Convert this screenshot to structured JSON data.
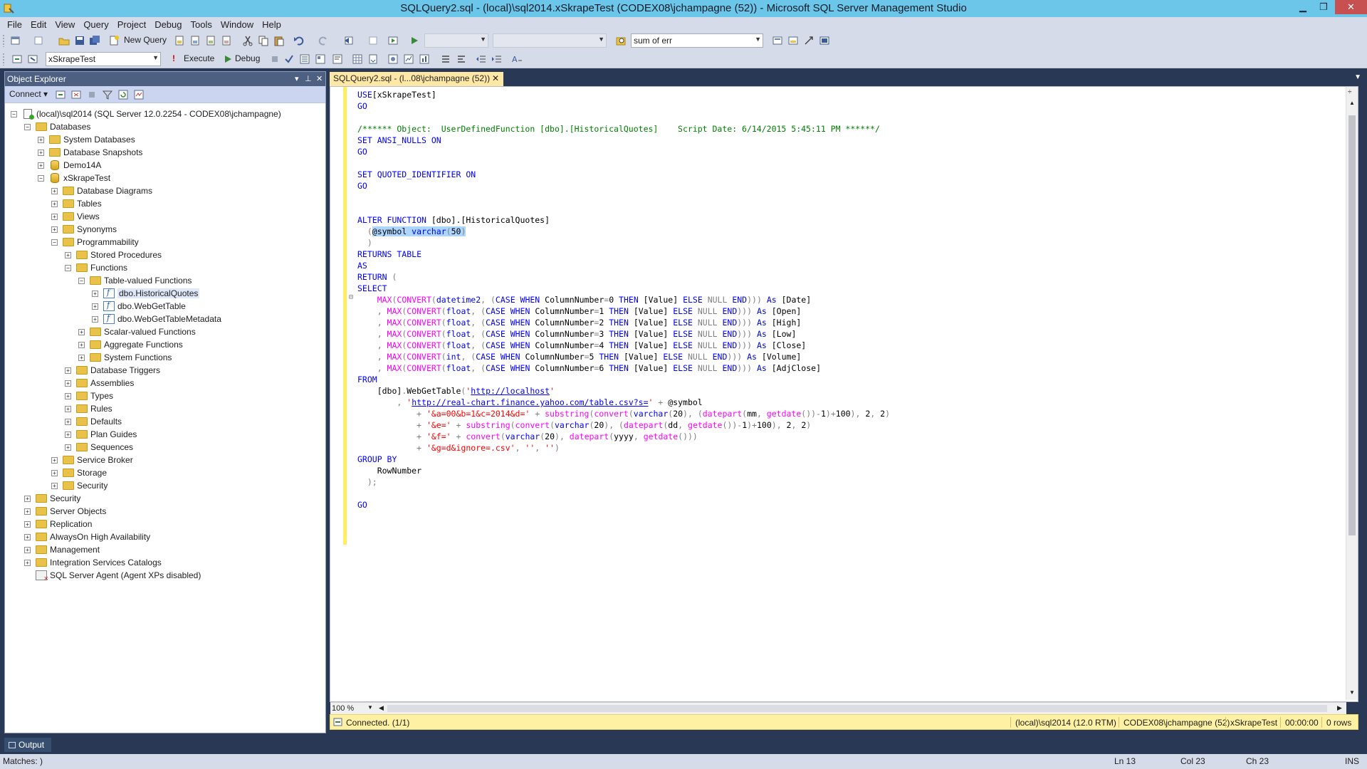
{
  "window": {
    "title": "SQLQuery2.sql - (local)\\sql2014.xSkrapeTest (CODEX08\\jchampagne (52)) - Microsoft SQL Server Management Studio",
    "minimize": "▁",
    "maximize": "❐",
    "close": "✕"
  },
  "menu": [
    "File",
    "Edit",
    "View",
    "Query",
    "Project",
    "Debug",
    "Tools",
    "Window",
    "Help"
  ],
  "toolbar1": {
    "new_query": "New Query",
    "search_combo": "sum of err"
  },
  "toolbar2": {
    "database": "xSkrapeTest",
    "execute": "Execute",
    "debug": "Debug"
  },
  "object_explorer": {
    "title": "Object Explorer",
    "connect": "Connect ▾",
    "tree": [
      {
        "label": "(local)\\sql2014 (SQL Server 12.0.2254 - CODEX08\\jchampagne)",
        "icon": "server-icon",
        "exp": "−"
      },
      {
        "label": "Databases",
        "icon": "folder-icon",
        "exp": "−"
      },
      {
        "label": "System Databases",
        "icon": "folder-icon",
        "exp": "+"
      },
      {
        "label": "Database Snapshots",
        "icon": "folder-icon",
        "exp": "+"
      },
      {
        "label": "Demo14A",
        "icon": "database-icon",
        "exp": "+"
      },
      {
        "label": "xSkrapeTest",
        "icon": "database-icon",
        "exp": "−"
      },
      {
        "label": "Database Diagrams",
        "icon": "folder-icon",
        "exp": "+"
      },
      {
        "label": "Tables",
        "icon": "folder-icon",
        "exp": "+"
      },
      {
        "label": "Views",
        "icon": "folder-icon",
        "exp": "+"
      },
      {
        "label": "Synonyms",
        "icon": "folder-icon",
        "exp": "+"
      },
      {
        "label": "Programmability",
        "icon": "folder-icon",
        "exp": "−"
      },
      {
        "label": "Stored Procedures",
        "icon": "folder-icon",
        "exp": "+"
      },
      {
        "label": "Functions",
        "icon": "folder-icon",
        "exp": "−"
      },
      {
        "label": "Table-valued Functions",
        "icon": "folder-icon",
        "exp": "−"
      },
      {
        "label": "dbo.HistoricalQuotes",
        "icon": "function-icon",
        "exp": "+",
        "selected": true
      },
      {
        "label": "dbo.WebGetTable",
        "icon": "function-icon",
        "exp": "+"
      },
      {
        "label": "dbo.WebGetTableMetadata",
        "icon": "function-icon",
        "exp": "+"
      },
      {
        "label": "Scalar-valued Functions",
        "icon": "folder-icon",
        "exp": "+"
      },
      {
        "label": "Aggregate Functions",
        "icon": "folder-icon",
        "exp": "+"
      },
      {
        "label": "System Functions",
        "icon": "folder-icon",
        "exp": "+"
      },
      {
        "label": "Database Triggers",
        "icon": "folder-icon",
        "exp": "+"
      },
      {
        "label": "Assemblies",
        "icon": "folder-icon",
        "exp": "+"
      },
      {
        "label": "Types",
        "icon": "folder-icon",
        "exp": "+"
      },
      {
        "label": "Rules",
        "icon": "folder-icon",
        "exp": "+"
      },
      {
        "label": "Defaults",
        "icon": "folder-icon",
        "exp": "+"
      },
      {
        "label": "Plan Guides",
        "icon": "folder-icon",
        "exp": "+"
      },
      {
        "label": "Sequences",
        "icon": "folder-icon",
        "exp": "+"
      },
      {
        "label": "Service Broker",
        "icon": "folder-icon",
        "exp": "+"
      },
      {
        "label": "Storage",
        "icon": "folder-icon",
        "exp": "+"
      },
      {
        "label": "Security",
        "icon": "folder-icon",
        "exp": "+"
      },
      {
        "label": "Security",
        "icon": "folder-icon",
        "exp": "+"
      },
      {
        "label": "Server Objects",
        "icon": "folder-icon",
        "exp": "+"
      },
      {
        "label": "Replication",
        "icon": "folder-icon",
        "exp": "+"
      },
      {
        "label": "AlwaysOn High Availability",
        "icon": "folder-icon",
        "exp": "+"
      },
      {
        "label": "Management",
        "icon": "folder-icon",
        "exp": "+"
      },
      {
        "label": "Integration Services Catalogs",
        "icon": "folder-icon",
        "exp": "+"
      },
      {
        "label": "SQL Server Agent (Agent XPs disabled)",
        "icon": "agent-icon",
        "exp": ""
      }
    ]
  },
  "editor": {
    "tab_label": "SQLQuery2.sql - (l...08\\jchampagne (52))",
    "tab_close": "✕",
    "zoom": "100 %",
    "code_lines": [
      [
        [
          "kw",
          "USE"
        ],
        [
          "",
          "[xSkrapeTest]"
        ]
      ],
      [
        [
          "kw",
          "GO"
        ]
      ],
      [
        [
          "",
          ""
        ]
      ],
      [
        [
          "cm",
          "/****** Object:  UserDefinedFunction [dbo].[HistoricalQuotes]    Script Date: 6/14/2015 5:45:11 PM ******/"
        ]
      ],
      [
        [
          "kw",
          "SET ANSI_NULLS ON"
        ]
      ],
      [
        [
          "kw",
          "GO"
        ]
      ],
      [
        [
          "",
          ""
        ]
      ],
      [
        [
          "kw",
          "SET QUOTED_IDENTIFIER ON"
        ]
      ],
      [
        [
          "kw",
          "GO"
        ]
      ],
      [
        [
          "",
          ""
        ]
      ],
      [
        [
          "",
          ""
        ]
      ],
      [
        [
          "kw",
          "ALTER FUNCTION"
        ],
        [
          "",
          " [dbo].[HistoricalQuotes]"
        ]
      ],
      [
        [
          "gy",
          "  ("
        ],
        [
          "hl",
          "@symbol "
        ],
        [
          "hl-kw",
          "varchar"
        ],
        [
          "hl-gy",
          "("
        ],
        [
          "hl",
          "50"
        ],
        [
          "hl-gy",
          ")"
        ]
      ],
      [
        [
          "gy",
          "  )"
        ]
      ],
      [
        [
          "kw",
          "RETURNS TABLE"
        ]
      ],
      [
        [
          "kw",
          "AS"
        ]
      ],
      [
        [
          "kw",
          "RETURN"
        ],
        [
          "gy",
          " ("
        ]
      ],
      [
        [
          "kw",
          "SELECT"
        ]
      ],
      [
        [
          "",
          "    "
        ],
        [
          "fn",
          "MAX"
        ],
        [
          "gy",
          "("
        ],
        [
          "fn",
          "CONVERT"
        ],
        [
          "gy",
          "("
        ],
        [
          "kw",
          "datetime2"
        ],
        [
          "gy",
          ", ("
        ],
        [
          "kw",
          "CASE WHEN"
        ],
        [
          "",
          " ColumnNumber"
        ],
        [
          "gy",
          "="
        ],
        [
          "",
          "0 "
        ],
        [
          "kw",
          "THEN"
        ],
        [
          "",
          " [Value] "
        ],
        [
          "kw",
          "ELSE"
        ],
        [
          "gy",
          " NULL "
        ],
        [
          "kw",
          "END"
        ],
        [
          "gy",
          ")))"
        ],
        [
          "",
          " "
        ],
        [
          "kw",
          "As"
        ],
        [
          "",
          " [Date]"
        ]
      ],
      [
        [
          "gy",
          "    , "
        ],
        [
          "fn",
          "MAX"
        ],
        [
          "gy",
          "("
        ],
        [
          "fn",
          "CONVERT"
        ],
        [
          "gy",
          "("
        ],
        [
          "kw",
          "float"
        ],
        [
          "gy",
          ", ("
        ],
        [
          "kw",
          "CASE WHEN"
        ],
        [
          "",
          " ColumnNumber"
        ],
        [
          "gy",
          "="
        ],
        [
          "",
          "1 "
        ],
        [
          "kw",
          "THEN"
        ],
        [
          "",
          " [Value] "
        ],
        [
          "kw",
          "ELSE"
        ],
        [
          "gy",
          " NULL "
        ],
        [
          "kw",
          "END"
        ],
        [
          "gy",
          ")))"
        ],
        [
          "",
          " "
        ],
        [
          "kw",
          "As"
        ],
        [
          "",
          " [Open]"
        ]
      ],
      [
        [
          "gy",
          "    , "
        ],
        [
          "fn",
          "MAX"
        ],
        [
          "gy",
          "("
        ],
        [
          "fn",
          "CONVERT"
        ],
        [
          "gy",
          "("
        ],
        [
          "kw",
          "float"
        ],
        [
          "gy",
          ", ("
        ],
        [
          "kw",
          "CASE WHEN"
        ],
        [
          "",
          " ColumnNumber"
        ],
        [
          "gy",
          "="
        ],
        [
          "",
          "2 "
        ],
        [
          "kw",
          "THEN"
        ],
        [
          "",
          " [Value] "
        ],
        [
          "kw",
          "ELSE"
        ],
        [
          "gy",
          " NULL "
        ],
        [
          "kw",
          "END"
        ],
        [
          "gy",
          ")))"
        ],
        [
          "",
          " "
        ],
        [
          "kw",
          "As"
        ],
        [
          "",
          " [High]"
        ]
      ],
      [
        [
          "gy",
          "    , "
        ],
        [
          "fn",
          "MAX"
        ],
        [
          "gy",
          "("
        ],
        [
          "fn",
          "CONVERT"
        ],
        [
          "gy",
          "("
        ],
        [
          "kw",
          "float"
        ],
        [
          "gy",
          ", ("
        ],
        [
          "kw",
          "CASE WHEN"
        ],
        [
          "",
          " ColumnNumber"
        ],
        [
          "gy",
          "="
        ],
        [
          "",
          "3 "
        ],
        [
          "kw",
          "THEN"
        ],
        [
          "",
          " [Value] "
        ],
        [
          "kw",
          "ELSE"
        ],
        [
          "gy",
          " NULL "
        ],
        [
          "kw",
          "END"
        ],
        [
          "gy",
          ")))"
        ],
        [
          "",
          " "
        ],
        [
          "kw",
          "As"
        ],
        [
          "",
          " [Low]"
        ]
      ],
      [
        [
          "gy",
          "    , "
        ],
        [
          "fn",
          "MAX"
        ],
        [
          "gy",
          "("
        ],
        [
          "fn",
          "CONVERT"
        ],
        [
          "gy",
          "("
        ],
        [
          "kw",
          "float"
        ],
        [
          "gy",
          ", ("
        ],
        [
          "kw",
          "CASE WHEN"
        ],
        [
          "",
          " ColumnNumber"
        ],
        [
          "gy",
          "="
        ],
        [
          "",
          "4 "
        ],
        [
          "kw",
          "THEN"
        ],
        [
          "",
          " [Value] "
        ],
        [
          "kw",
          "ELSE"
        ],
        [
          "gy",
          " NULL "
        ],
        [
          "kw",
          "END"
        ],
        [
          "gy",
          ")))"
        ],
        [
          "",
          " "
        ],
        [
          "kw",
          "As"
        ],
        [
          "",
          " [Close]"
        ]
      ],
      [
        [
          "gy",
          "    , "
        ],
        [
          "fn",
          "MAX"
        ],
        [
          "gy",
          "("
        ],
        [
          "fn",
          "CONVERT"
        ],
        [
          "gy",
          "("
        ],
        [
          "kw",
          "int"
        ],
        [
          "gy",
          ", ("
        ],
        [
          "kw",
          "CASE WHEN"
        ],
        [
          "",
          " ColumnNumber"
        ],
        [
          "gy",
          "="
        ],
        [
          "",
          "5 "
        ],
        [
          "kw",
          "THEN"
        ],
        [
          "",
          " [Value] "
        ],
        [
          "kw",
          "ELSE"
        ],
        [
          "gy",
          " NULL "
        ],
        [
          "kw",
          "END"
        ],
        [
          "gy",
          ")))"
        ],
        [
          "",
          " "
        ],
        [
          "kw",
          "As"
        ],
        [
          "",
          " [Volume]"
        ]
      ],
      [
        [
          "gy",
          "    , "
        ],
        [
          "fn",
          "MAX"
        ],
        [
          "gy",
          "("
        ],
        [
          "fn",
          "CONVERT"
        ],
        [
          "gy",
          "("
        ],
        [
          "kw",
          "float"
        ],
        [
          "gy",
          ", ("
        ],
        [
          "kw",
          "CASE WHEN"
        ],
        [
          "",
          " ColumnNumber"
        ],
        [
          "gy",
          "="
        ],
        [
          "",
          "6 "
        ],
        [
          "kw",
          "THEN"
        ],
        [
          "",
          " [Value] "
        ],
        [
          "kw",
          "ELSE"
        ],
        [
          "gy",
          " NULL "
        ],
        [
          "kw",
          "END"
        ],
        [
          "gy",
          ")))"
        ],
        [
          "",
          " "
        ],
        [
          "kw",
          "As"
        ],
        [
          "",
          " [AdjClose]"
        ]
      ],
      [
        [
          "kw",
          "FROM"
        ]
      ],
      [
        [
          "",
          "    [dbo]"
        ],
        [
          "gy",
          "."
        ],
        [
          "",
          "WebGetTable"
        ],
        [
          "gy",
          "("
        ],
        [
          "st",
          "'"
        ],
        [
          "url",
          "http://localhost"
        ],
        [
          "st",
          "'"
        ]
      ],
      [
        [
          "gy",
          "        , "
        ],
        [
          "st",
          "'"
        ],
        [
          "url",
          "http://real-chart.finance.yahoo.com/table.csv?s="
        ],
        [
          "st",
          "'"
        ],
        [
          "gy",
          " + "
        ],
        [
          "",
          "@symbol"
        ]
      ],
      [
        [
          "gy",
          "            + "
        ],
        [
          "st",
          "'&a=00&b=1&c=2014&d='"
        ],
        [
          "gy",
          " + "
        ],
        [
          "fn",
          "substring"
        ],
        [
          "gy",
          "("
        ],
        [
          "fn",
          "convert"
        ],
        [
          "gy",
          "("
        ],
        [
          "kw",
          "varchar"
        ],
        [
          "gy",
          "("
        ],
        [
          "",
          "20"
        ],
        [
          "gy",
          "), ("
        ],
        [
          "fn",
          "datepart"
        ],
        [
          "gy",
          "("
        ],
        [
          "",
          "mm"
        ],
        [
          "gy",
          ", "
        ],
        [
          "fn",
          "getdate"
        ],
        [
          "gy",
          "())-"
        ],
        [
          "",
          "1"
        ],
        [
          "gy",
          ")+"
        ],
        [
          "",
          "100"
        ],
        [
          "gy",
          "), "
        ],
        [
          "",
          "2"
        ],
        [
          "gy",
          ", "
        ],
        [
          "",
          "2"
        ],
        [
          "gy",
          ")"
        ]
      ],
      [
        [
          "gy",
          "            + "
        ],
        [
          "st",
          "'&e='"
        ],
        [
          "gy",
          " + "
        ],
        [
          "fn",
          "substring"
        ],
        [
          "gy",
          "("
        ],
        [
          "fn",
          "convert"
        ],
        [
          "gy",
          "("
        ],
        [
          "kw",
          "varchar"
        ],
        [
          "gy",
          "("
        ],
        [
          "",
          "20"
        ],
        [
          "gy",
          "), ("
        ],
        [
          "fn",
          "datepart"
        ],
        [
          "gy",
          "("
        ],
        [
          "",
          "dd"
        ],
        [
          "gy",
          ", "
        ],
        [
          "fn",
          "getdate"
        ],
        [
          "gy",
          "())-"
        ],
        [
          "",
          "1"
        ],
        [
          "gy",
          ")+"
        ],
        [
          "",
          "100"
        ],
        [
          "gy",
          "), "
        ],
        [
          "",
          "2"
        ],
        [
          "gy",
          ", "
        ],
        [
          "",
          "2"
        ],
        [
          "gy",
          ")"
        ]
      ],
      [
        [
          "gy",
          "            + "
        ],
        [
          "st",
          "'&f='"
        ],
        [
          "gy",
          " + "
        ],
        [
          "fn",
          "convert"
        ],
        [
          "gy",
          "("
        ],
        [
          "kw",
          "varchar"
        ],
        [
          "gy",
          "("
        ],
        [
          "",
          "20"
        ],
        [
          "gy",
          "), "
        ],
        [
          "fn",
          "datepart"
        ],
        [
          "gy",
          "("
        ],
        [
          "",
          "yyyy"
        ],
        [
          "gy",
          ", "
        ],
        [
          "fn",
          "getdate"
        ],
        [
          "gy",
          "()))"
        ]
      ],
      [
        [
          "gy",
          "            + "
        ],
        [
          "st",
          "'&g=d&ignore=.csv'"
        ],
        [
          "gy",
          ", "
        ],
        [
          "st",
          "''"
        ],
        [
          "gy",
          ", "
        ],
        [
          "st",
          "''"
        ],
        [
          "gy",
          ")"
        ]
      ],
      [
        [
          "kw",
          "GROUP BY"
        ]
      ],
      [
        [
          "",
          "    RowNumber"
        ]
      ],
      [
        [
          "gy",
          "  );"
        ]
      ],
      [
        [
          "",
          ""
        ]
      ],
      [
        [
          "kw",
          "GO"
        ]
      ]
    ]
  },
  "query_status": {
    "connected": "Connected. (1/1)",
    "server": "(local)\\sql2014 (12.0 RTM)",
    "user": "CODEX08\\jchampagne (52)",
    "database": "xSkrapeTest",
    "time": "00:00:00",
    "rows": "0 rows"
  },
  "output_tab": "Output",
  "status_bar": {
    "message": "Matches: )",
    "ln": "Ln 13",
    "col": "Col 23",
    "ch": "Ch 23",
    "mode": "INS"
  },
  "colors": {
    "titlebar": "#6cc6e9",
    "chrome": "#293955",
    "editor_tab": "#ffe8a6",
    "status_yellow": "#fff1a4"
  }
}
